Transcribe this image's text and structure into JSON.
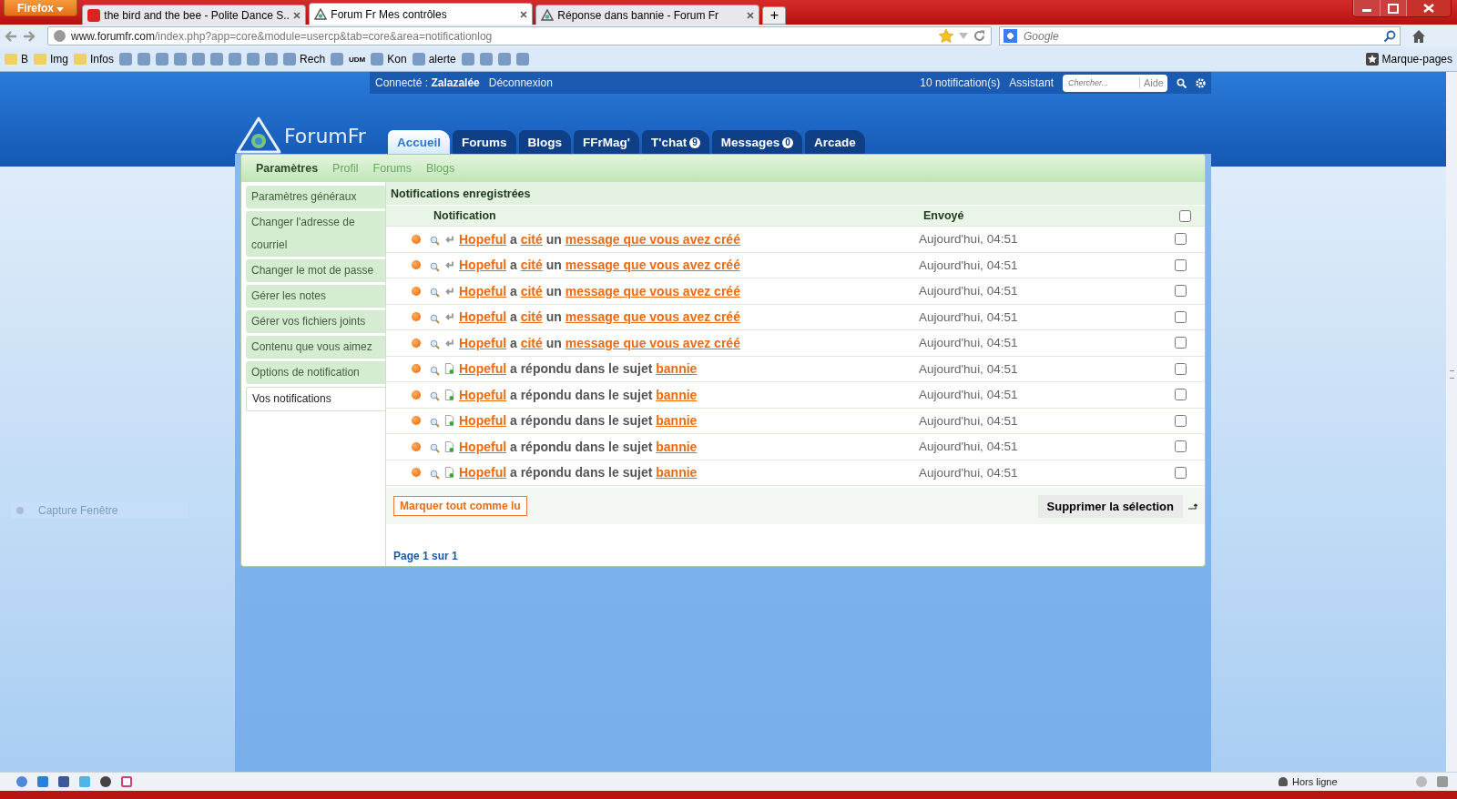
{
  "browser": {
    "menu_button": "Firefox",
    "tabs": [
      {
        "title": "the bird and the bee - Polite Dance S...",
        "kind": "video",
        "selected": false
      },
      {
        "title": "Forum Fr Mes contrôles",
        "kind": "forum",
        "selected": true
      },
      {
        "title": "Réponse dans bannie - Forum Fr",
        "kind": "forum",
        "selected": false
      }
    ],
    "new_tab": "+",
    "url_domain": "www.forumfr.com",
    "url_path": "/index.php?app=core&module=usercp&tab=core&area=notificationlog",
    "search_placeholder": "Google",
    "bookmarks": [
      {
        "kind": "folder",
        "label": "B"
      },
      {
        "kind": "folder",
        "label": "Img"
      },
      {
        "kind": "folder",
        "label": "Infos"
      },
      {
        "kind": "site"
      },
      {
        "kind": "site"
      },
      {
        "kind": "site"
      },
      {
        "kind": "site"
      },
      {
        "kind": "site"
      },
      {
        "kind": "site"
      },
      {
        "kind": "site"
      },
      {
        "kind": "site"
      },
      {
        "kind": "site"
      },
      {
        "kind": "site",
        "label": "Rech"
      },
      {
        "kind": "site"
      },
      {
        "kind": "text",
        "label": "UDM"
      },
      {
        "kind": "site",
        "label": "Kon"
      },
      {
        "kind": "site",
        "label": "alerte"
      },
      {
        "kind": "site"
      },
      {
        "kind": "site"
      },
      {
        "kind": "site"
      },
      {
        "kind": "site"
      }
    ],
    "bookmarks_menu": "Marque-pages"
  },
  "site": {
    "logo": "ForumFr",
    "user_bar": {
      "connected_label": "Connecté :",
      "username": "Zalazalée",
      "logout": "Déconnexion",
      "notifications": "10 notification(s)",
      "assistant": "Assistant",
      "search_placeholder": "Chercher...",
      "help": "Aide"
    },
    "nav_tabs": [
      {
        "label": "Accueil",
        "selected": true
      },
      {
        "label": "Forums",
        "selected": false
      },
      {
        "label": "Blogs",
        "selected": false
      },
      {
        "label": "FFrMag'",
        "selected": false
      },
      {
        "label": "T'chat",
        "badge": "9",
        "selected": false
      },
      {
        "label": "Messages",
        "badge": "0",
        "selected": false
      },
      {
        "label": "Arcade",
        "selected": false
      }
    ],
    "sub_tabs": [
      {
        "label": "Paramètres",
        "selected": true
      },
      {
        "label": "Profil",
        "selected": false
      },
      {
        "label": "Forums",
        "selected": false
      },
      {
        "label": "Blogs",
        "selected": false
      }
    ],
    "sidebar": {
      "items": [
        {
          "label": "Paramètres généraux",
          "selected": false
        },
        {
          "label": "Changer l'adresse de courriel",
          "selected": false
        },
        {
          "label": "Changer le mot de passe",
          "selected": false
        },
        {
          "label": "Gérer les notes",
          "selected": false
        },
        {
          "label": "Gérer vos fichiers joints",
          "selected": false
        },
        {
          "label": "Contenu que vous aimez",
          "selected": false
        },
        {
          "label": "Options de notification",
          "selected": false
        },
        {
          "label": "Vos notifications",
          "selected": true
        }
      ]
    },
    "panel": {
      "title": "Notifications enregistrées",
      "columns": [
        "Notification",
        "Envoyé"
      ],
      "rows": [
        {
          "kind": "quote",
          "user": "Hopeful",
          "text_1": "a",
          "action": "cité",
          "text_2": "un",
          "target": "message que vous avez créé",
          "sent": "Aujourd'hui, 04:51",
          "checked": false
        },
        {
          "kind": "quote",
          "user": "Hopeful",
          "text_1": "a",
          "action": "cité",
          "text_2": "un",
          "target": "message que vous avez créé",
          "sent": "Aujourd'hui, 04:51",
          "checked": false
        },
        {
          "kind": "quote",
          "user": "Hopeful",
          "text_1": "a",
          "action": "cité",
          "text_2": "un",
          "target": "message que vous avez créé",
          "sent": "Aujourd'hui, 04:51",
          "checked": false
        },
        {
          "kind": "quote",
          "user": "Hopeful",
          "text_1": "a",
          "action": "cité",
          "text_2": "un",
          "target": "message que vous avez créé",
          "sent": "Aujourd'hui, 04:51",
          "checked": false
        },
        {
          "kind": "quote",
          "user": "Hopeful",
          "text_1": "a",
          "action": "cité",
          "text_2": "un",
          "target": "message que vous avez créé",
          "sent": "Aujourd'hui, 04:51",
          "checked": false
        },
        {
          "kind": "reply",
          "user": "Hopeful",
          "text_1": "a répondu dans le sujet",
          "target": "bannie",
          "sent": "Aujourd'hui, 04:51",
          "checked": false
        },
        {
          "kind": "reply",
          "user": "Hopeful",
          "text_1": "a répondu dans le sujet",
          "target": "bannie",
          "sent": "Aujourd'hui, 04:51",
          "checked": false
        },
        {
          "kind": "reply",
          "user": "Hopeful",
          "text_1": "a répondu dans le sujet",
          "target": "bannie",
          "sent": "Aujourd'hui, 04:51",
          "checked": false
        },
        {
          "kind": "reply",
          "user": "Hopeful",
          "text_1": "a répondu dans le sujet",
          "target": "bannie",
          "sent": "Aujourd'hui, 04:51",
          "checked": false
        },
        {
          "kind": "reply",
          "user": "Hopeful",
          "text_1": "a répondu dans le sujet",
          "target": "bannie",
          "sent": "Aujourd'hui, 04:51",
          "checked": false
        }
      ],
      "select_all_checked": false,
      "mark_all_button": "Marquer tout comme lu",
      "delete_button": "Supprimer la sélection",
      "pagination": "Page 1 sur 1"
    }
  },
  "capture_widget": "Capture Fenêtre",
  "status_bar": {
    "presence": "Hors ligne"
  }
}
